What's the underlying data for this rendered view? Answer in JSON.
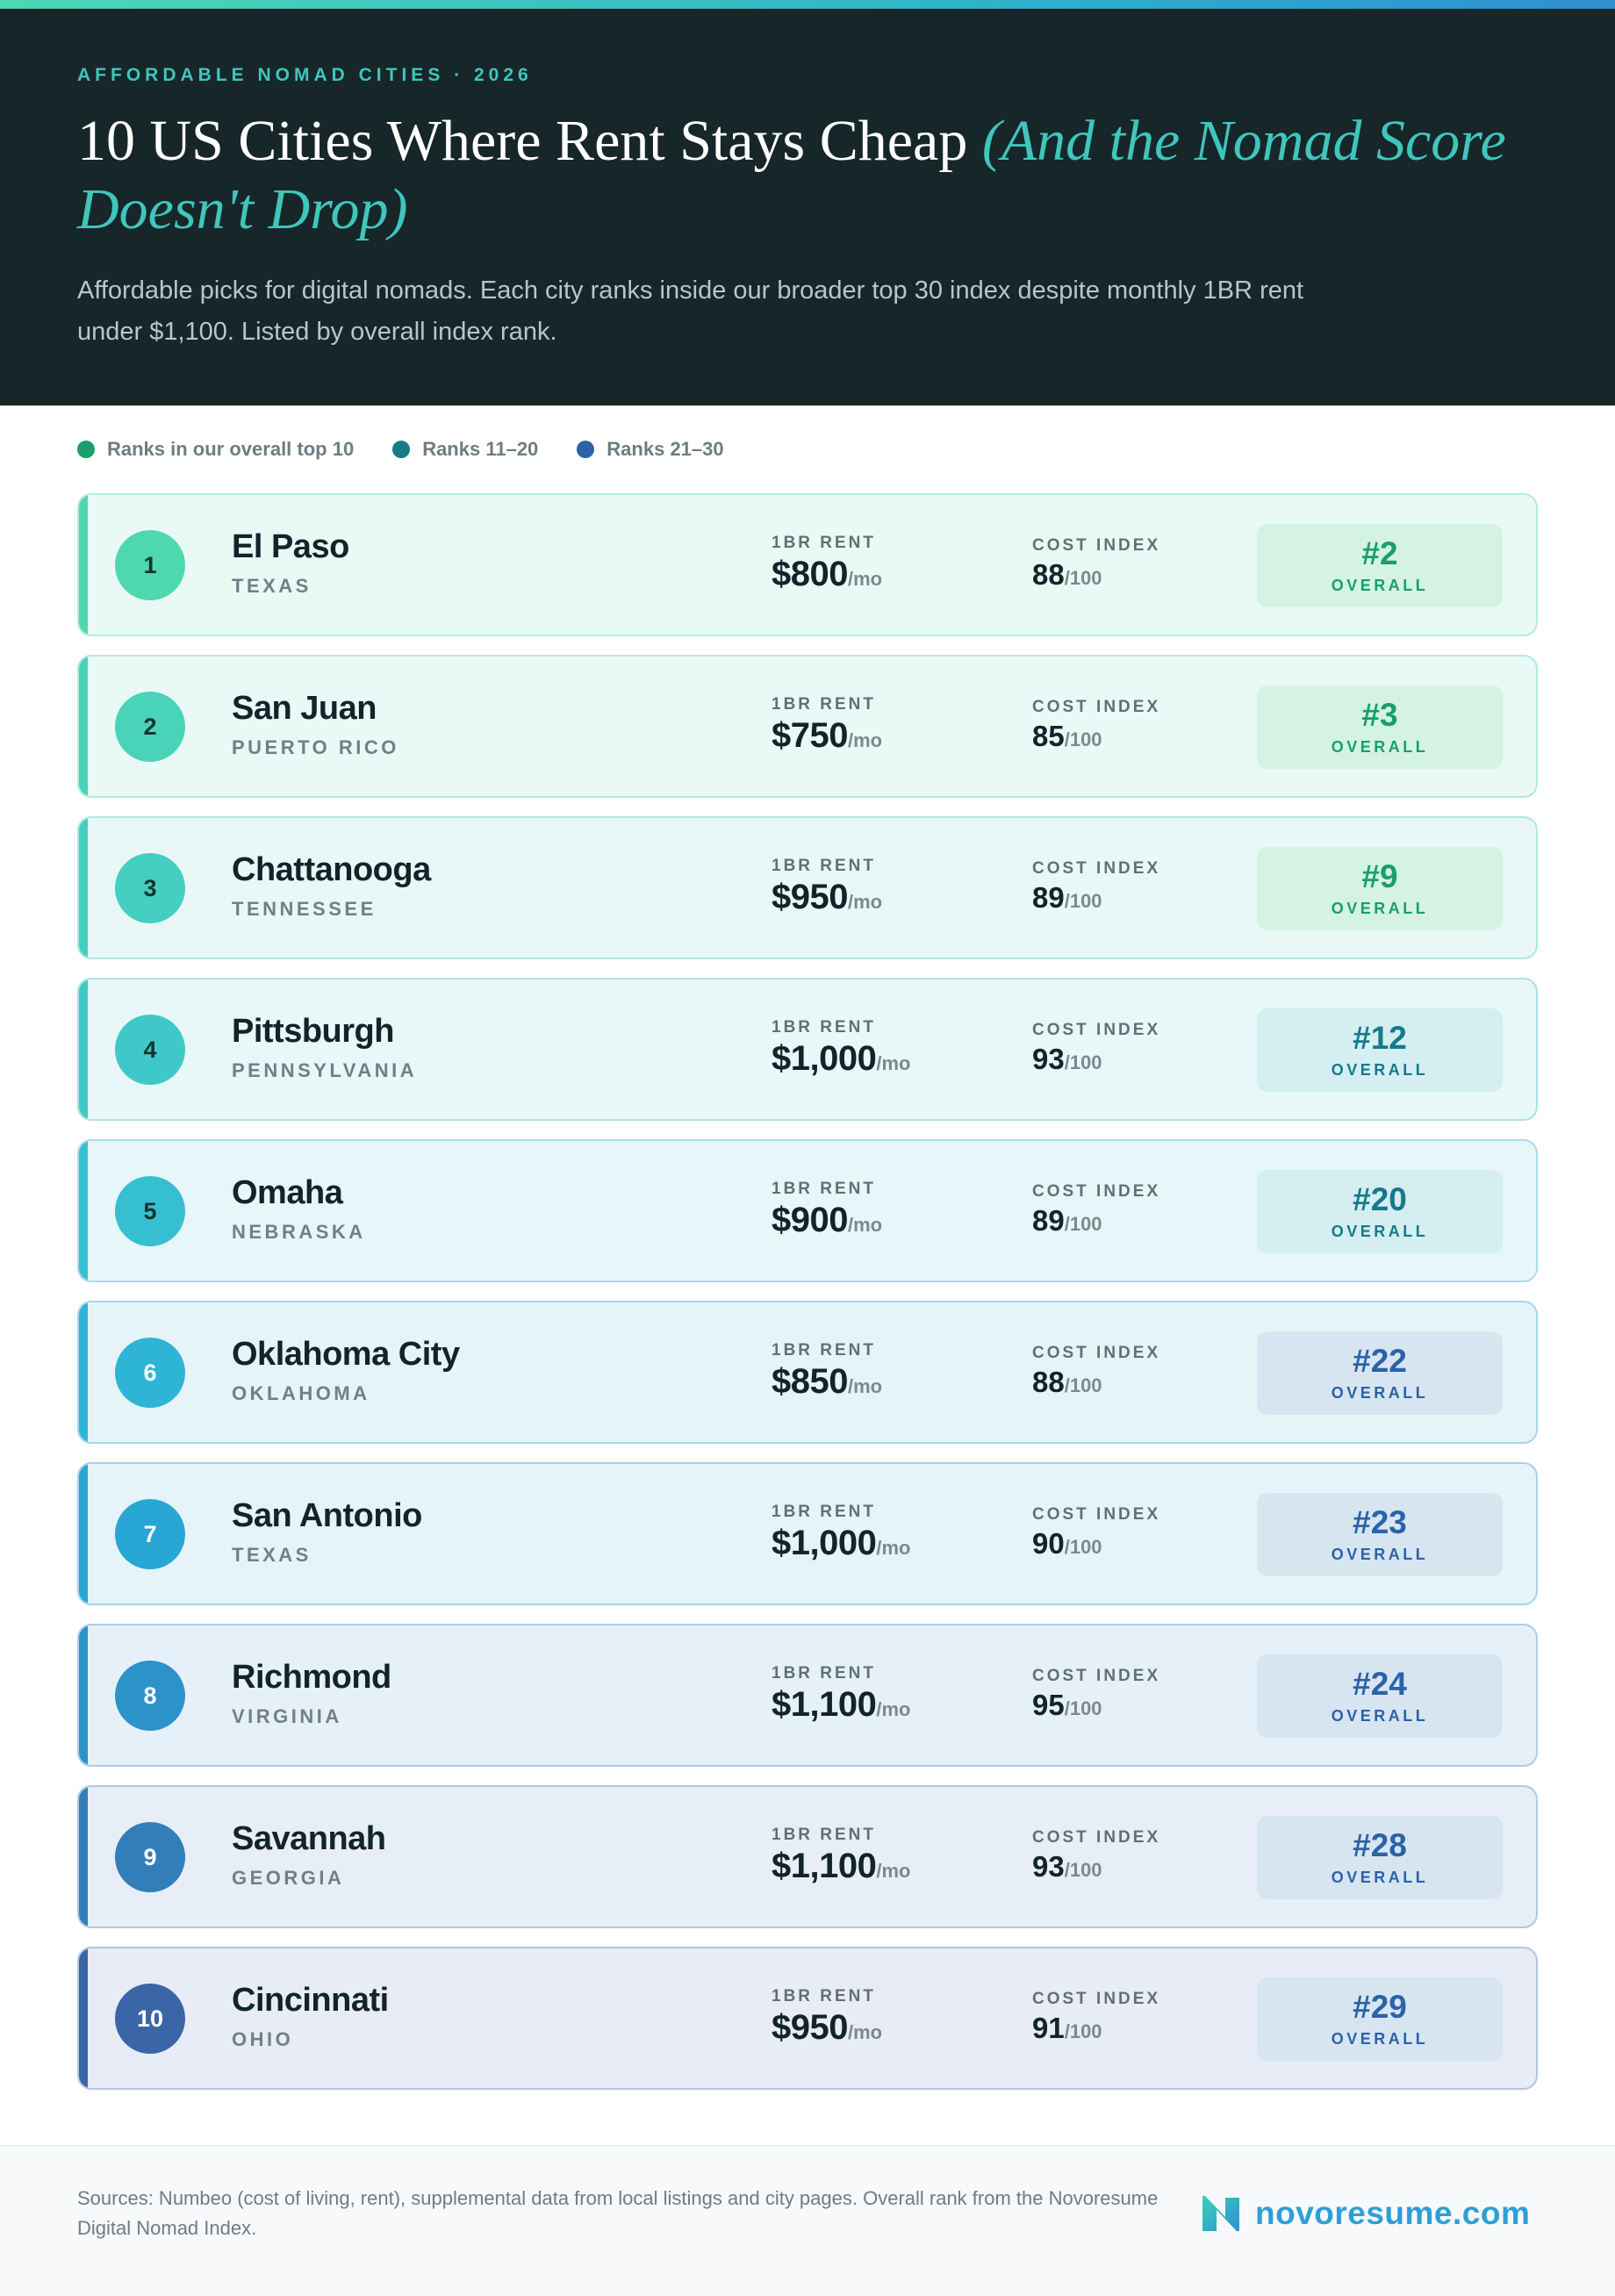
{
  "header": {
    "eyebrow": "AFFORDABLE NOMAD CITIES · 2026",
    "title_main": "10 US Cities Where Rent Stays Cheap",
    "title_accent": "(And the Nomad Score Doesn't Drop)",
    "subtitle": "Affordable picks for digital nomads. Each city ranks inside our broader top 30 index despite monthly 1BR rent under $1,100. Listed by overall index rank."
  },
  "legend": [
    {
      "label": "Ranks in our overall top 10",
      "color": "#1a9e6c"
    },
    {
      "label": "Ranks 11–20",
      "color": "#17798c"
    },
    {
      "label": "Ranks 21–30",
      "color": "#2c62a8"
    }
  ],
  "labels": {
    "rent": "1BR RENT",
    "cost": "COST INDEX",
    "rent_unit": "/mo",
    "cost_unit": "/100",
    "overall": "OVERALL"
  },
  "cities": [
    {
      "num": "1",
      "city": "El Paso",
      "state": "TEXAS",
      "rent": "$800",
      "cost": "88",
      "overall": "#2",
      "tier": "top10",
      "accent": "#4fd8b0"
    },
    {
      "num": "2",
      "city": "San Juan",
      "state": "PUERTO RICO",
      "rent": "$750",
      "cost": "85",
      "overall": "#3",
      "tier": "top10",
      "accent": "#49d3b8"
    },
    {
      "num": "3",
      "city": "Chattanooga",
      "state": "TENNESSEE",
      "rent": "$950",
      "cost": "89",
      "overall": "#9",
      "tier": "top10",
      "accent": "#44cfc0"
    },
    {
      "num": "4",
      "city": "Pittsburgh",
      "state": "PENNSYLVANIA",
      "rent": "$1,000",
      "cost": "93",
      "overall": "#12",
      "tier": "mid",
      "accent": "#3ec9c8"
    },
    {
      "num": "5",
      "city": "Omaha",
      "state": "NEBRASKA",
      "rent": "$900",
      "cost": "89",
      "overall": "#20",
      "tier": "mid",
      "accent": "#36bfd0"
    },
    {
      "num": "6",
      "city": "Oklahoma City",
      "state": "OKLAHOMA",
      "rent": "$850",
      "cost": "88",
      "overall": "#22",
      "tier": "low",
      "accent": "#2eb4d4"
    },
    {
      "num": "7",
      "city": "San Antonio",
      "state": "TEXAS",
      "rent": "$1,000",
      "cost": "90",
      "overall": "#23",
      "tier": "low",
      "accent": "#28a6d4"
    },
    {
      "num": "8",
      "city": "Richmond",
      "state": "VIRGINIA",
      "rent": "$1,100",
      "cost": "95",
      "overall": "#24",
      "tier": "low",
      "accent": "#2c93c9"
    },
    {
      "num": "9",
      "city": "Savannah",
      "state": "GEORGIA",
      "rent": "$1,100",
      "cost": "93",
      "overall": "#28",
      "tier": "low",
      "accent": "#327eb9"
    },
    {
      "num": "10",
      "city": "Cincinnati",
      "state": "OHIO",
      "rent": "$950",
      "cost": "91",
      "overall": "#29",
      "tier": "low",
      "accent": "#3a66a8"
    }
  ],
  "footer": {
    "sources": "Sources: Numbeo (cost of living, rent), supplemental data from local listings and city pages. Overall rank from the Novoresume Digital Nomad Index.",
    "brand": "novoresume.com"
  }
}
